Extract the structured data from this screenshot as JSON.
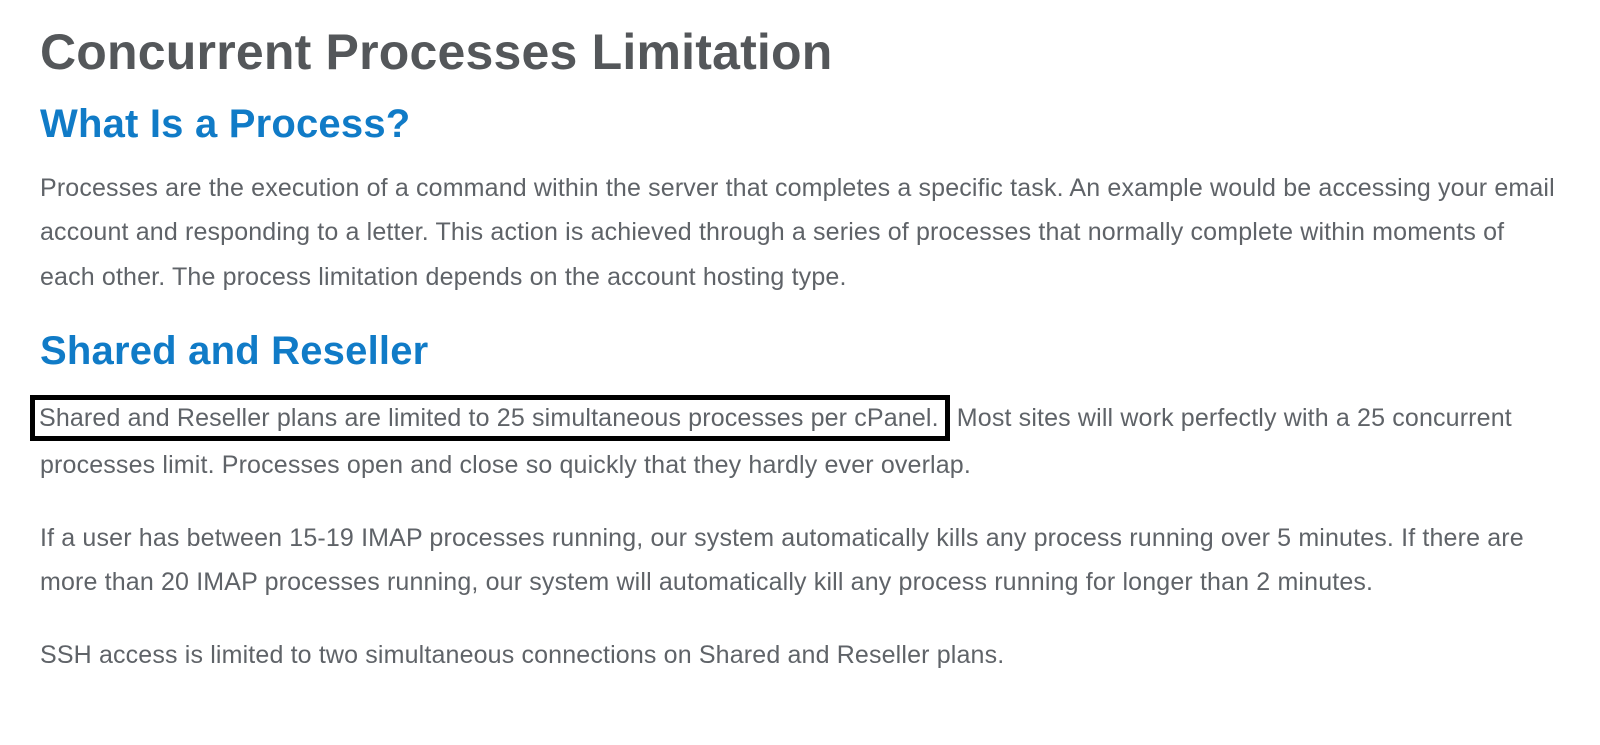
{
  "title": "Concurrent Processes Limitation",
  "sections": {
    "what_is_process": {
      "heading": "What Is a Process?",
      "body": "Processes are the execution of a command within the server that completes a specific task. An example would be accessing your email account and responding to a letter. This action is achieved through a series of processes that normally complete within moments of each other. The process limitation depends on the account hosting type."
    },
    "shared_reseller": {
      "heading": "Shared and Reseller",
      "highlighted_sentence": "Shared and Reseller plans are limited to 25 simultaneous processes per cPanel.",
      "rest_first_para": " Most sites will work perfectly with a 25 concurrent processes limit. Processes open and close so quickly that they hardly ever overlap.",
      "imap_para": "If a user has between 15-19 IMAP processes running, our system automatically kills any process running over 5 minutes. If there are more than 20 IMAP processes running, our system will automatically kill any process running for longer than 2 minutes.",
      "ssh_para": "SSH access is limited to two simultaneous connections on Shared and Reseller plans."
    }
  }
}
